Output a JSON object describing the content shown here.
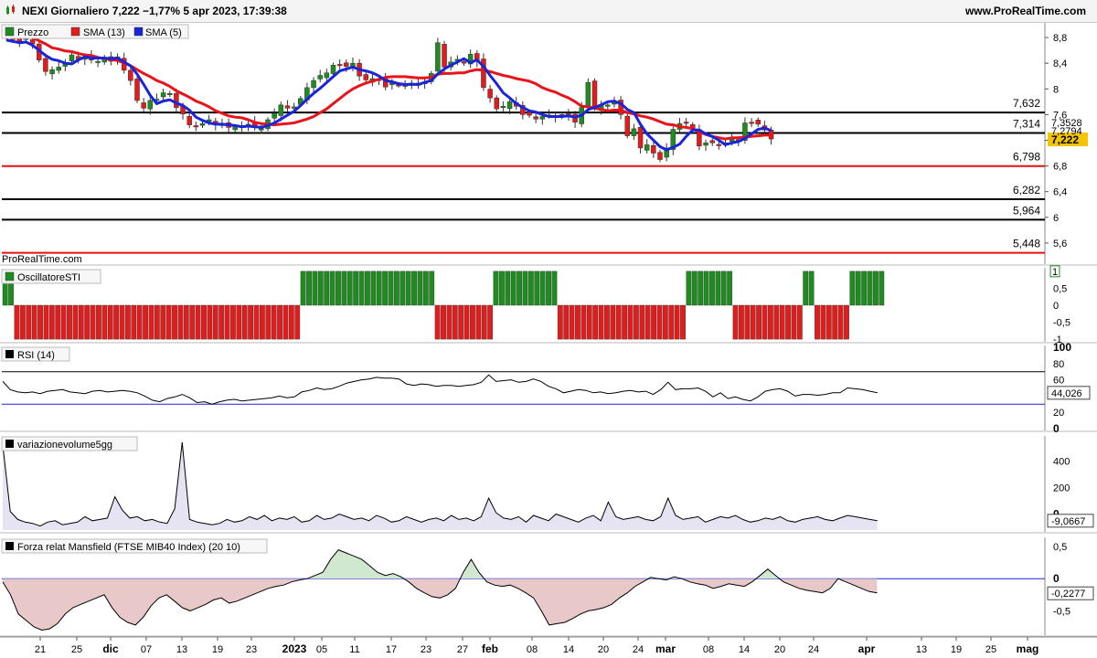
{
  "header": {
    "title": "NEXI Giornaliero 7,222 −1,77% 5 apr 2023, 17:39:38",
    "site": "www.ProRealTime.com",
    "watermark": "ProRealTime.com"
  },
  "colors": {
    "up": "#1e8c1e",
    "down": "#e21b1b",
    "sma13": "#e8141a",
    "sma5": "#1a25d8",
    "hline_black": "#000000",
    "hline_red": "#e81010",
    "price_tag": "#f5c400"
  },
  "chart_data": [
    {
      "type": "candlestick",
      "panel": "price",
      "legend": [
        {
          "name": "Prezzo"
        },
        {
          "name": "SMA (13)"
        },
        {
          "name": "SMA (5)"
        }
      ],
      "x_ticks": [
        "21",
        "25",
        "dic",
        "07",
        "13",
        "19",
        "23",
        "2023",
        "05",
        "11",
        "17",
        "23",
        "27",
        "feb",
        "08",
        "14",
        "20",
        "24",
        "mar",
        "08",
        "14",
        "20",
        "24",
        "apr",
        "13",
        "19",
        "25",
        "mag"
      ],
      "ylim": [
        5.3,
        9.0
      ],
      "y_ticks": [
        "8,8",
        "8,4",
        "8",
        "7,6",
        "7,2",
        "6,8",
        "6,4",
        "6",
        "5,6"
      ],
      "levels": [
        {
          "value": 7.632,
          "label": "7,632",
          "color": "black"
        },
        {
          "value": 7.314,
          "label": "7,314",
          "color": "black"
        },
        {
          "value": 6.798,
          "label": "6,798",
          "color": "red"
        },
        {
          "value": 6.282,
          "label": "6,282",
          "color": "black"
        },
        {
          "value": 5.964,
          "label": "5,964",
          "color": "black"
        },
        {
          "value": 5.448,
          "label": "5,448",
          "color": "red"
        }
      ],
      "last_values": {
        "sma13": "7,2794",
        "sma5": "7,3528",
        "price": "7,222"
      },
      "close": [
        8.8,
        8.78,
        8.74,
        8.79,
        8.7,
        8.45,
        8.27,
        8.3,
        8.34,
        8.4,
        8.53,
        8.46,
        8.49,
        8.45,
        8.43,
        8.49,
        8.43,
        8.5,
        8.29,
        8.13,
        7.82,
        7.7,
        7.82,
        7.84,
        7.94,
        7.93,
        7.71,
        7.61,
        7.44,
        7.42,
        7.46,
        7.52,
        7.44,
        7.45,
        7.4,
        7.41,
        7.42,
        7.45,
        7.4,
        7.38,
        7.52,
        7.62,
        7.75,
        7.7,
        7.72,
        7.85,
        8.02,
        8.13,
        8.21,
        8.25,
        8.37,
        8.37,
        8.35,
        8.4,
        8.2,
        8.14,
        8.16,
        8.15,
        8.03,
        8.09,
        8.06,
        8.06,
        8.09,
        8.09,
        8.1,
        8.24,
        8.72,
        8.34,
        8.42,
        8.46,
        8.4,
        8.54,
        8.43,
        8.02,
        7.86,
        7.69,
        7.73,
        7.8,
        7.73,
        7.6,
        7.59,
        7.53,
        7.57,
        7.59,
        7.58,
        7.6,
        7.57,
        7.48,
        7.71,
        8.1,
        7.7,
        7.74,
        7.75,
        7.79,
        7.6,
        7.27,
        7.38,
        7.08,
        7.13,
        7.0,
        6.9,
        7.08,
        7.37,
        7.46,
        7.48,
        7.38,
        7.11,
        7.16,
        7.16,
        7.13,
        7.16,
        7.23,
        7.21,
        7.47,
        7.48,
        7.45,
        7.36,
        7.22
      ],
      "sma13": [
        8.95,
        8.92,
        8.88,
        8.84,
        8.8,
        8.75,
        8.7,
        8.64,
        8.62,
        8.59,
        8.58,
        8.55,
        8.53,
        8.52,
        8.49,
        8.47,
        8.46,
        8.44,
        8.41,
        8.36,
        8.3,
        8.24,
        8.19,
        8.13,
        8.09,
        8.04,
        7.97,
        7.92,
        7.87,
        7.81,
        7.77,
        7.72,
        7.66,
        7.62,
        7.58,
        7.56,
        7.55,
        7.52,
        7.48,
        7.46,
        7.45,
        7.44,
        7.45,
        7.46,
        7.47,
        7.5,
        7.53,
        7.57,
        7.63,
        7.69,
        7.77,
        7.85,
        7.93,
        8.0,
        8.05,
        8.09,
        8.12,
        8.15,
        8.18,
        8.19,
        8.19,
        8.19,
        8.18,
        8.17,
        8.17,
        8.18,
        8.23,
        8.24,
        8.24,
        8.25,
        8.25,
        8.28,
        8.3,
        8.29,
        8.27,
        8.24,
        8.21,
        8.19,
        8.16,
        8.14,
        8.12,
        8.08,
        8.02,
        7.98,
        7.95,
        7.9,
        7.86,
        7.8,
        7.73,
        7.72,
        7.7,
        7.68,
        7.66,
        7.67,
        7.67,
        7.63,
        7.61,
        7.58,
        7.56,
        7.53,
        7.49,
        7.45,
        7.44,
        7.41,
        7.4,
        7.38,
        7.33,
        7.29,
        7.26,
        7.24,
        7.22,
        7.24,
        7.24,
        7.25,
        7.26,
        7.27,
        7.28,
        7.28
      ],
      "sma5": [
        8.76,
        8.74,
        8.72,
        8.73,
        8.68,
        8.6,
        8.52,
        8.46,
        8.44,
        8.4,
        8.39,
        8.45,
        8.5,
        8.48,
        8.48,
        8.48,
        8.47,
        8.48,
        8.42,
        8.36,
        8.23,
        8.07,
        7.9,
        7.77,
        7.81,
        7.83,
        7.78,
        7.74,
        7.67,
        7.56,
        7.51,
        7.47,
        7.45,
        7.45,
        7.44,
        7.43,
        7.41,
        7.42,
        7.41,
        7.4,
        7.43,
        7.47,
        7.53,
        7.59,
        7.65,
        7.74,
        7.84,
        7.93,
        8.01,
        8.1,
        8.19,
        8.28,
        8.31,
        8.34,
        8.3,
        8.28,
        8.25,
        8.2,
        8.13,
        8.11,
        8.08,
        8.07,
        8.07,
        8.07,
        8.1,
        8.13,
        8.23,
        8.31,
        8.37,
        8.42,
        8.47,
        8.41,
        8.45,
        8.35,
        8.21,
        8.08,
        7.94,
        7.86,
        7.77,
        7.71,
        7.66,
        7.64,
        7.6,
        7.57,
        7.57,
        7.57,
        7.58,
        7.56,
        7.59,
        7.68,
        7.71,
        7.75,
        7.8,
        7.81,
        7.77,
        7.68,
        7.63,
        7.45,
        7.3,
        7.2,
        7.1,
        7.05,
        7.09,
        7.14,
        7.26,
        7.36,
        7.36,
        7.3,
        7.26,
        7.2,
        7.13,
        7.16,
        7.18,
        7.23,
        7.3,
        7.37,
        7.39,
        7.35
      ]
    },
    {
      "type": "bar",
      "panel": "sti",
      "title": "OscillatoreSTI",
      "y_ticks": [
        "0,5",
        "0",
        "-0,5",
        "-1"
      ],
      "last_value_label": "1",
      "values": [
        1,
        1,
        -1,
        -1,
        -1,
        -1,
        -1,
        -1,
        -1,
        -1,
        -1,
        -1,
        -1,
        -1,
        -1,
        -1,
        -1,
        -1,
        -1,
        -1,
        -1,
        -1,
        -1,
        -1,
        -1,
        -1,
        -1,
        -1,
        -1,
        -1,
        -1,
        -1,
        -1,
        -1,
        -1,
        -1,
        -1,
        -1,
        -1,
        -1,
        -1,
        -1,
        -1,
        -1,
        -1,
        -1,
        -1,
        -1,
        -1,
        -1,
        -1,
        1,
        1,
        1,
        1,
        1,
        1,
        1,
        1,
        1,
        1,
        1,
        1,
        1,
        1,
        1,
        1,
        1,
        1,
        1,
        1,
        1,
        1,
        1,
        -1,
        -1,
        -1,
        -1,
        -1,
        -1,
        -1,
        -1,
        -1,
        -1,
        1,
        1,
        1,
        1,
        1,
        1,
        1,
        1,
        1,
        1,
        1,
        -1,
        -1,
        -1,
        -1,
        -1,
        -1,
        -1,
        -1,
        -1,
        -1,
        -1,
        -1,
        -1,
        -1,
        -1,
        -1,
        -1,
        -1,
        -1,
        -1,
        -1,
        -1,
        1,
        1,
        1,
        1,
        1,
        1,
        1,
        1,
        -1,
        -1,
        -1,
        -1,
        -1,
        -1,
        -1,
        -1,
        -1,
        -1,
        -1,
        -1,
        1,
        1,
        -1,
        -1,
        -1,
        -1,
        -1,
        -1,
        1,
        1,
        1,
        1,
        1,
        1
      ]
    },
    {
      "type": "line",
      "panel": "rsi",
      "title": "RSI (14)",
      "ylim": [
        0,
        100
      ],
      "y_ticks": [
        "100",
        "80",
        "60",
        "40",
        "20",
        "0"
      ],
      "levels": [
        70,
        30
      ],
      "last_value_label": "44,026",
      "values": [
        58,
        48,
        45,
        44,
        45,
        43,
        46,
        47,
        48,
        45,
        44,
        43,
        46,
        47,
        45,
        46,
        47,
        46,
        44,
        40,
        35,
        33,
        37,
        39,
        42,
        38,
        32,
        33,
        30,
        33,
        35,
        36,
        34,
        35,
        36,
        37,
        38,
        40,
        38,
        39,
        45,
        47,
        50,
        48,
        49,
        52,
        56,
        58,
        60,
        61,
        63,
        62,
        62,
        61,
        55,
        53,
        55,
        54,
        52,
        53,
        53,
        52,
        53,
        54,
        57,
        66,
        58,
        59,
        60,
        57,
        58,
        61,
        58,
        52,
        49,
        44,
        46,
        48,
        47,
        44,
        45,
        43,
        44,
        46,
        47,
        45,
        46,
        42,
        48,
        57,
        48,
        49,
        49,
        50,
        46,
        39,
        44,
        37,
        39,
        36,
        34,
        39,
        46,
        48,
        49,
        46,
        40,
        42,
        42,
        41,
        42,
        44,
        44,
        50,
        49,
        48,
        46,
        44
      ]
    },
    {
      "type": "area",
      "panel": "volume",
      "title": "variazionevolume5gg",
      "y_ticks": [
        "400",
        "200",
        "0"
      ],
      "last_value_label": "-9,0667",
      "values": [
        520,
        20,
        -40,
        -60,
        -70,
        -90,
        -60,
        -50,
        -80,
        -70,
        -60,
        -20,
        -50,
        -40,
        -30,
        130,
        30,
        -30,
        -20,
        -50,
        -40,
        -60,
        -70,
        40,
        540,
        -40,
        -60,
        -70,
        -80,
        -70,
        -40,
        -60,
        -50,
        -20,
        -40,
        -10,
        -50,
        -30,
        -40,
        -20,
        -60,
        -50,
        -10,
        -40,
        -30,
        0,
        -20,
        -40,
        -30,
        -50,
        -10,
        -30,
        -60,
        -50,
        -20,
        -40,
        -60,
        -40,
        -30,
        -50,
        -10,
        -40,
        -30,
        -50,
        -20,
        120,
        10,
        -30,
        -40,
        -20,
        -60,
        -10,
        -30,
        -50,
        0,
        -20,
        -40,
        -60,
        -30,
        -10,
        -50,
        90,
        -20,
        -40,
        -30,
        -20,
        -40,
        -50,
        -20,
        120,
        -10,
        -40,
        -30,
        -20,
        -60,
        -40,
        -20,
        -30,
        -10,
        -40,
        -60,
        -50,
        -30,
        -40,
        -20,
        -50,
        -60,
        -40,
        -30,
        -20,
        -40,
        -50,
        -30,
        -10,
        -20,
        -30,
        -40,
        -50
      ]
    },
    {
      "type": "area",
      "panel": "mansfield",
      "title": "Forza relat Mansfield (FTSE MIB40 Index) (20 10)",
      "ylim": [
        -0.85,
        0.6
      ],
      "y_ticks": [
        "0,5",
        "0",
        "-0,5"
      ],
      "last_value_label": "-0,2277",
      "values": [
        -0.05,
        -0.25,
        -0.55,
        -0.65,
        -0.75,
        -0.8,
        -0.78,
        -0.7,
        -0.55,
        -0.45,
        -0.4,
        -0.35,
        -0.3,
        -0.25,
        -0.45,
        -0.6,
        -0.68,
        -0.72,
        -0.6,
        -0.42,
        -0.3,
        -0.25,
        -0.35,
        -0.45,
        -0.5,
        -0.45,
        -0.4,
        -0.33,
        -0.3,
        -0.38,
        -0.35,
        -0.3,
        -0.25,
        -0.2,
        -0.15,
        -0.12,
        -0.1,
        -0.05,
        -0.02,
        0.0,
        0.05,
        0.1,
        0.3,
        0.45,
        0.4,
        0.35,
        0.3,
        0.2,
        0.1,
        0.05,
        0.08,
        0.03,
        -0.05,
        -0.15,
        -0.22,
        -0.28,
        -0.3,
        -0.25,
        -0.15,
        0.1,
        0.3,
        0.1,
        -0.05,
        -0.1,
        -0.12,
        -0.1,
        -0.15,
        -0.22,
        -0.3,
        -0.5,
        -0.72,
        -0.7,
        -0.68,
        -0.62,
        -0.55,
        -0.5,
        -0.48,
        -0.45,
        -0.4,
        -0.3,
        -0.22,
        -0.12,
        -0.05,
        0.02,
        0.0,
        -0.02,
        0.03,
        0.0,
        -0.05,
        -0.08,
        -0.1,
        -0.15,
        -0.12,
        -0.08,
        -0.1,
        -0.12,
        -0.05,
        0.05,
        0.15,
        0.05,
        -0.05,
        -0.1,
        -0.15,
        -0.18,
        -0.2,
        -0.22,
        -0.15,
        0.0,
        -0.05,
        -0.1,
        -0.15,
        -0.2,
        -0.22
      ]
    }
  ]
}
